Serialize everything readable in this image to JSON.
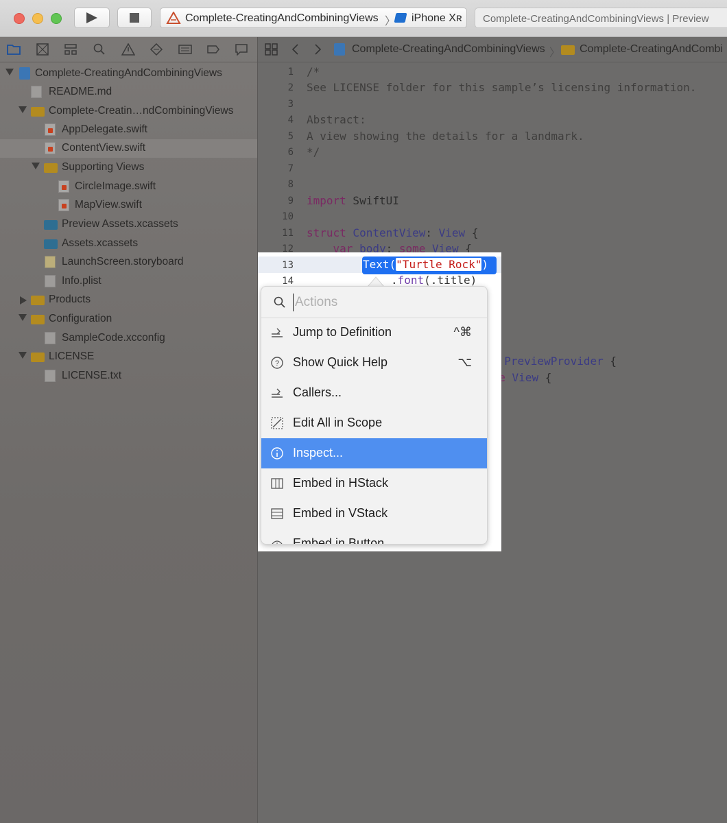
{
  "toolbar": {
    "scheme_name": "Complete-CreatingAndCombiningViews",
    "separator": "〉",
    "device": "iPhone Xʀ",
    "activity": "Complete-CreatingAndCombiningViews | Preview"
  },
  "navigator": {
    "items": [
      {
        "label": "Complete-CreatingAndCombiningViews"
      },
      {
        "label": "README.md"
      },
      {
        "label": "Complete-Creatin…ndCombiningViews"
      },
      {
        "label": "AppDelegate.swift"
      },
      {
        "label": "ContentView.swift"
      },
      {
        "label": "Supporting Views"
      },
      {
        "label": "CircleImage.swift"
      },
      {
        "label": "MapView.swift"
      },
      {
        "label": "Preview Assets.xcassets"
      },
      {
        "label": "Assets.xcassets"
      },
      {
        "label": "LaunchScreen.storyboard"
      },
      {
        "label": "Info.plist"
      },
      {
        "label": "Products"
      },
      {
        "label": "Configuration"
      },
      {
        "label": "SampleCode.xcconfig"
      },
      {
        "label": "LICENSE"
      },
      {
        "label": "LICENSE.txt"
      }
    ]
  },
  "jumpbar": {
    "project": "Complete-CreatingAndCombiningViews",
    "sep": "〉",
    "folder": "Complete-CreatingAndCombi"
  },
  "code": {
    "l1": "/*",
    "l2": "See LICENSE folder for this sample’s licensing information.",
    "l4": "Abstract:",
    "l5": "A view showing the details for a landmark.",
    "l6": "*/",
    "l9_kw": "import",
    "l9_rest": " SwiftUI",
    "l11_kw": "struct",
    "l11_name": " ContentView",
    "l11_colon": ": ",
    "l11_type": "View",
    "l11_brace": " {",
    "l12_indent": "    ",
    "l12_kw": "var",
    "l12_name": " body",
    "l12_colon": ": ",
    "l12_kw2": "some",
    "l12_type": " View",
    "l12_brace": " {",
    "l13_fn": "Text(",
    "l13_str": "\"Turtle Rock\"",
    "l13_close": ")",
    "l14_dot": ".",
    "l14_fn": "font",
    "l14_arg": "(.title)",
    "l17_colon": ": ",
    "l17_type": "PreviewProvider",
    "l17_brace": " {",
    "l18_kw": "ome",
    "l18_type": " View",
    "l18_brace": " {"
  },
  "menu": {
    "search_placeholder": "Actions",
    "items": [
      {
        "label": "Jump to Definition",
        "shortcut": "^⌘"
      },
      {
        "label": "Show Quick Help",
        "shortcut": "⌥"
      },
      {
        "label": "Callers...",
        "shortcut": ""
      },
      {
        "label": "Edit All in Scope",
        "shortcut": ""
      },
      {
        "label": "Inspect...",
        "shortcut": ""
      },
      {
        "label": "Embed in HStack",
        "shortcut": ""
      },
      {
        "label": "Embed in VStack",
        "shortcut": ""
      },
      {
        "label": "Embed in Button",
        "shortcut": ""
      }
    ],
    "active_index": 4
  },
  "colors": {
    "highlight": "#4f8ff0",
    "selection": "#1e6ff1",
    "keyword": "#ad3da4",
    "string": "#c41a16",
    "type": "#703daa"
  }
}
